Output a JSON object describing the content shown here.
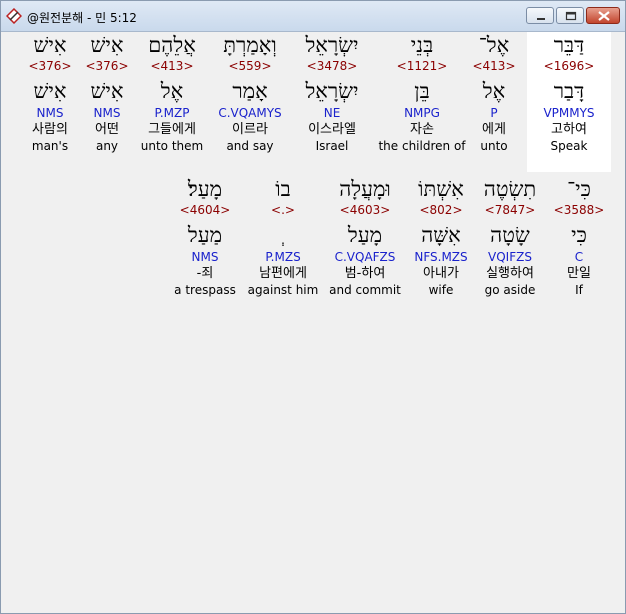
{
  "window": {
    "title": "@원전분해 - 민 5:12"
  },
  "row1": [
    {
      "heb": "דַּבֵּר",
      "num": "<1696>",
      "root": "דָּבַר",
      "morph": "VPMMYS",
      "kor": "고하여",
      "eng": "Speak"
    },
    {
      "heb": "אֶל־",
      "num": "<413>",
      "root": "אֶל",
      "morph": "P",
      "kor": "에게",
      "eng": "unto"
    },
    {
      "heb": "בְּנֵי",
      "num": "<1121>",
      "root": "בֵּן",
      "morph": "NMPG",
      "kor": "자손",
      "eng": "the children of"
    },
    {
      "heb": "יִשְׂרָאֵל",
      "num": "<3478>",
      "root": "יִשְׂרָאֵל",
      "morph": "NE",
      "kor": "이스라엘",
      "eng": "Israel"
    },
    {
      "heb": "וְאָמַרְתָּ",
      "num": "<559>",
      "root": "אָמַר",
      "morph": "C.VQAMYS",
      "kor": "이르라",
      "eng": "and say"
    },
    {
      "heb": "אֲלֵהֶם",
      "num": "<413>",
      "root": "אֶל",
      "morph": "P.MZP",
      "kor": "그들에게",
      "eng": "unto them"
    },
    {
      "heb": "אִישׁ",
      "num": "<376>",
      "root": "אִישׁ",
      "morph": "NMS",
      "kor": "어떤",
      "eng": "any"
    },
    {
      "heb": "אִישׁ",
      "num": "<376>",
      "root": "אִישׁ",
      "morph": "NMS",
      "kor": "사람의",
      "eng": "man's"
    }
  ],
  "row2": [
    {
      "heb": "כִּי־",
      "num": "<3588>",
      "root": "כִּי",
      "morph": "C",
      "kor": "만일",
      "eng": "If"
    },
    {
      "heb": "תִשְׂטֶה",
      "num": "<7847>",
      "root": "שָׂטָה",
      "morph": "VQIFZS",
      "kor": "실행하여",
      "eng": "go aside"
    },
    {
      "heb": "אִשְׁתּוֹ",
      "num": "<802>",
      "root": "אִשָּׁה",
      "morph": "NFS.MZS",
      "kor": "아내가",
      "eng": "wife"
    },
    {
      "heb": "וּמָעֲלָה",
      "num": "<4603>",
      "root": "מָעַל",
      "morph": "C.VQAFZS",
      "kor": "범-하여",
      "eng": "and commit"
    },
    {
      "heb": "בוֹ",
      "num": "<.>",
      "root": "ְ",
      "morph": "P.MZS",
      "kor": "남편에게",
      "eng": "against him"
    },
    {
      "heb": "מָעַל׃",
      "num": "<4604>",
      "root": "מַעַל",
      "morph": "NMS",
      "kor": "-죄",
      "eng": "a trespass"
    }
  ]
}
